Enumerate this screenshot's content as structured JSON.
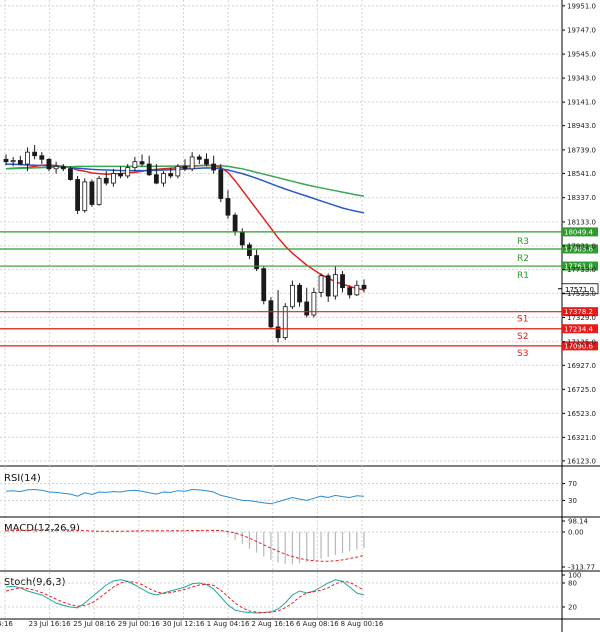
{
  "chart_data": {
    "type": "candlestick",
    "price_axis": {
      "ticks": [
        19951.0,
        19747.0,
        19545.0,
        19343.0,
        19141.0,
        18943.0,
        18739.0,
        18541.0,
        18337.0,
        18133.0,
        17931.0,
        17733.0,
        17533.0,
        17329.0,
        17125.0,
        16927.0,
        16725.0,
        16523.0,
        16321.0,
        16123.0
      ],
      "tick_labels": [
        "19951.0",
        "19747.0",
        "19545.0",
        "19343.0",
        "19141.0",
        "18943.0",
        "18739.0",
        "18541.0",
        "18337.0",
        "18133.0",
        "17931.0",
        "17733.0",
        "17533.0",
        "17329.0",
        "17125.0",
        "16927.0",
        "16725.0",
        "16523.0",
        "16321.0",
        "16123.0"
      ],
      "range": [
        16080,
        20000
      ]
    },
    "time_axis": {
      "labels": [
        "4:16",
        "23 Jul 16:16",
        "25 Jul 08:16",
        "29 Jul 00:16",
        "30 Jul 12:16",
        "1 Aug 04:16",
        "2 Aug 16:16",
        "6 Aug 08:16",
        "8 Aug 00:16"
      ]
    },
    "candles": [
      {
        "o": 18660,
        "h": 18700,
        "l": 18610,
        "c": 18640
      },
      {
        "o": 18640,
        "h": 18680,
        "l": 18600,
        "c": 18650
      },
      {
        "o": 18650,
        "h": 18690,
        "l": 18610,
        "c": 18620
      },
      {
        "o": 18620,
        "h": 18760,
        "l": 18560,
        "c": 18720
      },
      {
        "o": 18720,
        "h": 18780,
        "l": 18660,
        "c": 18690
      },
      {
        "o": 18690,
        "h": 18720,
        "l": 18620,
        "c": 18660
      },
      {
        "o": 18660,
        "h": 18670,
        "l": 18560,
        "c": 18580
      },
      {
        "o": 18580,
        "h": 18640,
        "l": 18540,
        "c": 18600
      },
      {
        "o": 18600,
        "h": 18620,
        "l": 18560,
        "c": 18580
      },
      {
        "o": 18580,
        "h": 18600,
        "l": 18480,
        "c": 18490
      },
      {
        "o": 18490,
        "h": 18520,
        "l": 18200,
        "c": 18230
      },
      {
        "o": 18230,
        "h": 18500,
        "l": 18210,
        "c": 18470
      },
      {
        "o": 18470,
        "h": 18490,
        "l": 18260,
        "c": 18280
      },
      {
        "o": 18280,
        "h": 18520,
        "l": 18270,
        "c": 18500
      },
      {
        "o": 18500,
        "h": 18560,
        "l": 18440,
        "c": 18460
      },
      {
        "o": 18460,
        "h": 18580,
        "l": 18430,
        "c": 18540
      },
      {
        "o": 18540,
        "h": 18600,
        "l": 18500,
        "c": 18520
      },
      {
        "o": 18520,
        "h": 18620,
        "l": 18500,
        "c": 18590
      },
      {
        "o": 18590,
        "h": 18680,
        "l": 18560,
        "c": 18640
      },
      {
        "o": 18640,
        "h": 18700,
        "l": 18600,
        "c": 18620
      },
      {
        "o": 18620,
        "h": 18690,
        "l": 18520,
        "c": 18530
      },
      {
        "o": 18530,
        "h": 18620,
        "l": 18450,
        "c": 18460
      },
      {
        "o": 18460,
        "h": 18560,
        "l": 18430,
        "c": 18540
      },
      {
        "o": 18540,
        "h": 18590,
        "l": 18500,
        "c": 18520
      },
      {
        "o": 18520,
        "h": 18620,
        "l": 18500,
        "c": 18600
      },
      {
        "o": 18600,
        "h": 18660,
        "l": 18560,
        "c": 18580
      },
      {
        "o": 18580,
        "h": 18720,
        "l": 18560,
        "c": 18680
      },
      {
        "o": 18680,
        "h": 18700,
        "l": 18620,
        "c": 18660
      },
      {
        "o": 18660,
        "h": 18710,
        "l": 18600,
        "c": 18620
      },
      {
        "o": 18620,
        "h": 18690,
        "l": 18540,
        "c": 18570
      },
      {
        "o": 18570,
        "h": 18620,
        "l": 18300,
        "c": 18330
      },
      {
        "o": 18330,
        "h": 18400,
        "l": 18160,
        "c": 18190
      },
      {
        "o": 18190,
        "h": 18210,
        "l": 18020,
        "c": 18050
      },
      {
        "o": 18050,
        "h": 18080,
        "l": 17900,
        "c": 17940
      },
      {
        "o": 17940,
        "h": 17960,
        "l": 17820,
        "c": 17850
      },
      {
        "o": 17850,
        "h": 17900,
        "l": 17720,
        "c": 17740
      },
      {
        "o": 17740,
        "h": 17760,
        "l": 17440,
        "c": 17470
      },
      {
        "o": 17470,
        "h": 17500,
        "l": 17230,
        "c": 17250
      },
      {
        "o": 17250,
        "h": 17560,
        "l": 17120,
        "c": 17160
      },
      {
        "o": 17160,
        "h": 17450,
        "l": 17140,
        "c": 17420
      },
      {
        "o": 17420,
        "h": 17640,
        "l": 17400,
        "c": 17600
      },
      {
        "o": 17600,
        "h": 17620,
        "l": 17420,
        "c": 17460
      },
      {
        "o": 17460,
        "h": 17580,
        "l": 17330,
        "c": 17350
      },
      {
        "o": 17350,
        "h": 17580,
        "l": 17330,
        "c": 17540
      },
      {
        "o": 17540,
        "h": 17700,
        "l": 17500,
        "c": 17680
      },
      {
        "o": 17680,
        "h": 17700,
        "l": 17460,
        "c": 17510
      },
      {
        "o": 17510,
        "h": 17760,
        "l": 17480,
        "c": 17690
      },
      {
        "o": 17690,
        "h": 17720,
        "l": 17540,
        "c": 17580
      },
      {
        "o": 17580,
        "h": 17600,
        "l": 17490,
        "c": 17520
      },
      {
        "o": 17520,
        "h": 17640,
        "l": 17510,
        "c": 17600
      },
      {
        "o": 17600,
        "h": 17650,
        "l": 17540,
        "c": 17571
      }
    ],
    "moving_averages": [
      {
        "color": "#e8201f",
        "values": [
          18580,
          18585,
          18588,
          18590,
          18600,
          18610,
          18612,
          18608,
          18600,
          18590,
          18570,
          18560,
          18545,
          18540,
          18535,
          18538,
          18540,
          18545,
          18550,
          18560,
          18570,
          18575,
          18580,
          18585,
          18590,
          18595,
          18600,
          18605,
          18610,
          18608,
          18590,
          18550,
          18480,
          18400,
          18320,
          18240,
          18160,
          18080,
          18000,
          17930,
          17870,
          17820,
          17770,
          17730,
          17690,
          17660,
          17630,
          17610,
          17590,
          17575,
          17560
        ]
      },
      {
        "color": "#2757c9",
        "values": [
          18620,
          18618,
          18615,
          18612,
          18610,
          18608,
          18605,
          18600,
          18595,
          18590,
          18585,
          18580,
          18575,
          18572,
          18570,
          18568,
          18566,
          18565,
          18565,
          18565,
          18566,
          18568,
          18570,
          18572,
          18575,
          18578,
          18582,
          18585,
          18588,
          18586,
          18580,
          18570,
          18555,
          18540,
          18520,
          18500,
          18478,
          18455,
          18432,
          18410,
          18390,
          18370,
          18350,
          18330,
          18310,
          18290,
          18270,
          18250,
          18235,
          18222,
          18210
        ]
      },
      {
        "color": "#3aa655",
        "values": [
          18580,
          18582,
          18584,
          18586,
          18588,
          18590,
          18592,
          18594,
          18596,
          18598,
          18600,
          18600,
          18600,
          18600,
          18600,
          18600,
          18600,
          18600,
          18600,
          18600,
          18600,
          18601,
          18602,
          18603,
          18604,
          18605,
          18606,
          18607,
          18608,
          18608,
          18605,
          18600,
          18590,
          18580,
          18566,
          18550,
          18535,
          18520,
          18505,
          18490,
          18475,
          18460,
          18445,
          18432,
          18420,
          18408,
          18396,
          18384,
          18372,
          18360,
          18350
        ]
      }
    ],
    "levels": [
      {
        "name": "R3",
        "value": 18049.4,
        "label": "18049.4"
      },
      {
        "name": "R2",
        "value": 17905.6,
        "label": "17905.6"
      },
      {
        "name": "R1",
        "value": 17761.8,
        "label": "17761.8"
      },
      {
        "name": "S1",
        "value": 17378.2,
        "label": "17378.2"
      },
      {
        "name": "S2",
        "value": 17234.4,
        "label": "17234.4"
      },
      {
        "name": "S3",
        "value": 17090.6,
        "label": "17090.6"
      }
    ],
    "level_colors": {
      "resistance": "#2c9a2c",
      "support": "#e41b1b"
    },
    "current_price": {
      "value": 17571.0,
      "label": "17571.0"
    },
    "indicators": {
      "rsi": {
        "title": "RSI(14)",
        "ticks": [
          "70",
          "30"
        ],
        "range": [
          0,
          100
        ],
        "tick_values": [
          70,
          30
        ],
        "values": [
          52,
          53,
          51,
          55,
          56,
          54,
          50,
          49,
          47,
          45,
          40,
          48,
          44,
          50,
          49,
          51,
          50,
          53,
          54,
          52,
          48,
          45,
          50,
          49,
          53,
          52,
          56,
          55,
          53,
          50,
          42,
          38,
          34,
          30,
          29,
          27,
          24,
          22,
          27,
          32,
          37,
          33,
          30,
          35,
          40,
          37,
          42,
          39,
          37,
          41,
          40
        ]
      },
      "macd": {
        "title": "MACD(12,26,9)",
        "ticks": [
          "98.14",
          "0.00",
          "-313.77"
        ],
        "range": [
          -313.77,
          98.14
        ],
        "tick_values": [
          98.14,
          0,
          -313.77
        ],
        "hist": [
          20,
          22,
          24,
          28,
          30,
          30,
          26,
          22,
          18,
          14,
          6,
          4,
          0,
          2,
          2,
          4,
          6,
          8,
          12,
          14,
          12,
          8,
          8,
          8,
          10,
          12,
          16,
          18,
          18,
          14,
          0,
          -30,
          -70,
          -110,
          -150,
          -185,
          -220,
          -250,
          -275,
          -285,
          -290,
          -280,
          -270,
          -255,
          -240,
          -225,
          -205,
          -190,
          -172,
          -158,
          -145
        ],
        "signal": [
          10,
          12,
          14,
          16,
          18,
          20,
          22,
          22,
          20,
          18,
          15,
          12,
          9,
          7,
          6,
          6,
          7,
          8,
          9,
          10,
          11,
          11,
          10,
          10,
          10,
          11,
          12,
          13,
          14,
          14,
          12,
          4,
          -10,
          -30,
          -55,
          -85,
          -115,
          -145,
          -172,
          -198,
          -220,
          -238,
          -250,
          -258,
          -262,
          -262,
          -258,
          -250,
          -238,
          -225,
          -210
        ]
      },
      "stoch": {
        "title": "Stoch(9,6,3)",
        "ticks": [
          "100",
          "80",
          "20"
        ],
        "range": [
          0,
          100
        ],
        "tick_values": [
          100,
          80,
          20
        ],
        "main": [
          70,
          72,
          68,
          60,
          55,
          50,
          40,
          30,
          24,
          20,
          18,
          30,
          45,
          60,
          75,
          85,
          88,
          84,
          75,
          65,
          55,
          50,
          55,
          60,
          65,
          70,
          78,
          80,
          76,
          65,
          45,
          25,
          12,
          8,
          6,
          5,
          6,
          8,
          15,
          30,
          50,
          60,
          55,
          60,
          70,
          80,
          88,
          84,
          70,
          55,
          50
        ],
        "signal": [
          60,
          64,
          68,
          66,
          62,
          56,
          48,
          40,
          32,
          26,
          22,
          24,
          30,
          42,
          56,
          70,
          80,
          84,
          82,
          76,
          66,
          58,
          54,
          56,
          60,
          64,
          70,
          75,
          77,
          74,
          62,
          46,
          30,
          18,
          10,
          7,
          6,
          7,
          10,
          18,
          30,
          45,
          55,
          58,
          62,
          68,
          78,
          84,
          82,
          72,
          62
        ]
      }
    }
  }
}
